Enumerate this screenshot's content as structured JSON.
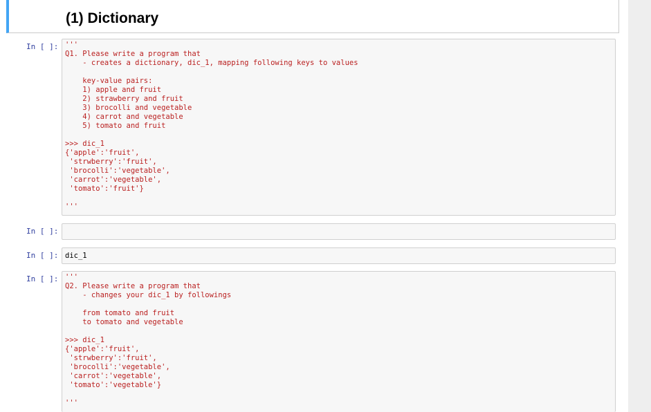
{
  "header": {
    "title": "(1) Dictionary"
  },
  "cells": [
    {
      "prompt": "In [ ]:",
      "source": "'''\nQ1. Please write a program that\n    - creates a dictionary, dic_1, mapping following keys to values\n\n    key-value pairs:\n    1) apple and fruit\n    2) strawberry and fruit\n    3) brocolli and vegetable\n    4) carrot and vegetable\n    5) tomato and fruit\n\n>>> dic_1\n{'apple':'fruit',\n 'strwberry':'fruit',\n 'brocolli':'vegetable',\n 'carrot':'vegetable',\n 'tomato':'fruit'}\n\n'''"
    },
    {
      "prompt": "In [ ]:",
      "source": ""
    },
    {
      "prompt": "In [ ]:",
      "source": "dic_1"
    },
    {
      "prompt": "In [ ]:",
      "source": "'''\nQ2. Please write a program that\n    - changes your dic_1 by followings\n\n    from tomato and fruit\n    to tomato and vegetable\n\n>>> dic_1\n{'apple':'fruit',\n 'strwberry':'fruit',\n 'brocolli':'vegetable',\n 'carrot':'vegetable',\n 'tomato':'vegetable'}\n\n'''"
    }
  ]
}
